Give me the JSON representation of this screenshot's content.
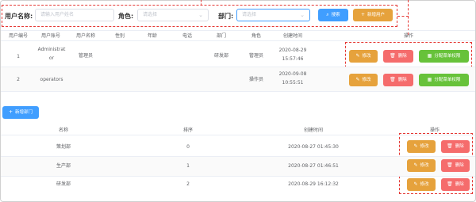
{
  "search": {
    "username_label": "用户名称:",
    "username_placeholder": "请输入用户姓名",
    "role_label": "角色:",
    "role_placeholder": "请选择",
    "dept_label": "部门:",
    "dept_placeholder": "请选择",
    "search_button": "搜索",
    "add_user_button": "新增用户"
  },
  "user_table": {
    "headers": [
      "用户编号",
      "用户账号",
      "用户名称",
      "性别",
      "年龄",
      "电话",
      "部门",
      "角色",
      "创建时间",
      "操作"
    ],
    "rows": [
      {
        "id": "1",
        "account_l1": "Administrat",
        "account_l2": "or",
        "name": "管理员",
        "dept": "研发部",
        "role": "管理员",
        "date": "2020-08-29",
        "time": "15:57:46"
      },
      {
        "id": "2",
        "account_l1": "operators",
        "account_l2": "",
        "name": "",
        "dept": "",
        "role": "操作员",
        "date": "2020-09-08",
        "time": "10:55:51"
      }
    ],
    "edit_label": "修改",
    "delete_label": "删除",
    "assign_label": "分配菜单权限"
  },
  "add_dept_button": "新增部门",
  "dept_table": {
    "headers": [
      "名称",
      "排序",
      "创建时间",
      "操作"
    ],
    "rows": [
      {
        "name": "策划部",
        "order": "0",
        "created": "2020-08-27 01:45:30"
      },
      {
        "name": "生产部",
        "order": "1",
        "created": "2020-08-27 01:46:51"
      },
      {
        "name": "研发部",
        "order": "2",
        "created": "2020-08-29 16:12:32"
      }
    ],
    "edit_label": "修改",
    "delete_label": "删除"
  },
  "colors": {
    "primary": "#409eff",
    "warning": "#e6a23c",
    "danger": "#f56c6c",
    "success": "#67c23a",
    "annotation": "#e53935"
  }
}
